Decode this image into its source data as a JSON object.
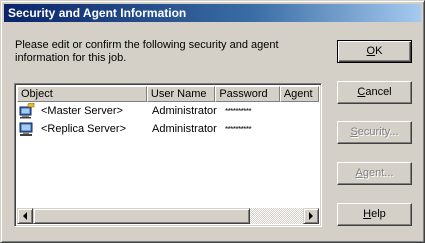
{
  "window": {
    "title": "Security and Agent Information"
  },
  "instructions": "Please edit or confirm the following security and agent information for this job.",
  "list": {
    "columns": [
      "Object",
      "User Name",
      "Password",
      "Agent"
    ],
    "rows": [
      {
        "object": "<Master Server>",
        "user_name": "Administrator",
        "password": "**********",
        "agent": "",
        "icon": "master-server-icon"
      },
      {
        "object": "<Replica Server>",
        "user_name": "Administrator",
        "password": "**********",
        "agent": "",
        "icon": "replica-server-icon"
      }
    ]
  },
  "buttons": {
    "ok": {
      "pre": "",
      "accel": "O",
      "post": "K"
    },
    "cancel": {
      "pre": "",
      "accel": "C",
      "post": "ancel"
    },
    "security": {
      "pre": "",
      "accel": "S",
      "post": "ecurity..."
    },
    "agent": {
      "pre": "",
      "accel": "A",
      "post": "gent..."
    },
    "help": {
      "pre": "",
      "accel": "H",
      "post": "elp"
    }
  },
  "colors": {
    "title_gradient_start": "#0a246a",
    "title_gradient_end": "#a6caf0",
    "face": "#d4d0c8"
  }
}
